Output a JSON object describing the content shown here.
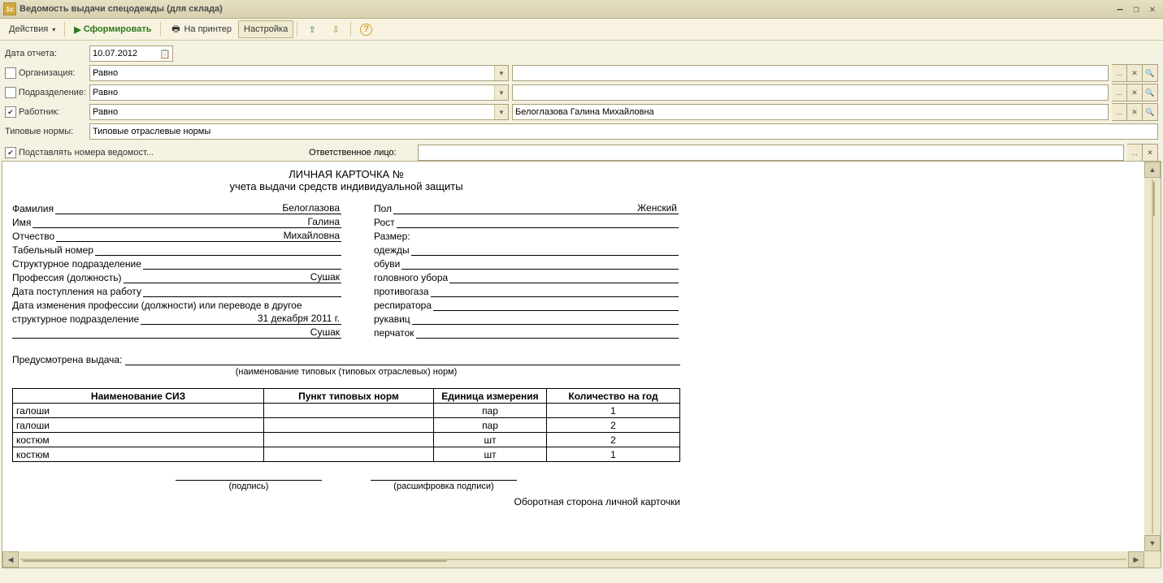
{
  "window": {
    "title": "Ведомость выдачи спецодежды (для склада)"
  },
  "toolbar": {
    "actions": "Действия",
    "form": "Сформировать",
    "print": "На принтер",
    "setup": "Настройка"
  },
  "filters": {
    "date_label": "Дата отчета:",
    "date": "10.07.2012",
    "org_label": "Организация:",
    "org_op": "Равно",
    "dep_label": "Подразделение:",
    "dep_op": "Равно",
    "worker_label": "Работник:",
    "worker_op": "Равно",
    "worker_val": "Белоглазова Галина Михайловна",
    "norms_label": "Типовые нормы:",
    "norms_val": "Типовые отраслевые нормы",
    "subst_label": "Подставлять номера ведомост...",
    "resp_label": "Ответственное лицо:"
  },
  "doc": {
    "title1": "ЛИЧНАЯ КАРТОЧКА №",
    "title2": "учета выдачи средств индивидуальной защиты",
    "surname_l": "Фамилия",
    "surname_v": "Белоглазова",
    "name_l": "Имя",
    "name_v": "Галина",
    "patr_l": "Отчество",
    "patr_v": "Михайловна",
    "tab_l": "Табельный номер",
    "struct_l": "Структурное подразделение",
    "prof_l": "Профессия (должность)",
    "prof_v": "Сушак",
    "hire_l": "Дата поступления на работу",
    "change_l": "Дата изменения профессии (должности) или переводе в другое",
    "change_l2": "структурное подразделение",
    "change_v": "31 декабря 2011 г.",
    "change_v2": "Сушак",
    "sex_l": "Пол",
    "sex_v": "Женский",
    "height_l": "Рост",
    "size_l": "Размер:",
    "clothes_l": "одежды",
    "shoes_l": "обуви",
    "head_l": "головного убора",
    "gas_l": "противогаза",
    "resp_l": "респиратора",
    "mitt_l": "рукавиц",
    "glove_l": "перчаток",
    "pre_l": "Предусмотрена выдача:",
    "pre_note": "(наименование типовых (типовых отраслевых) норм)",
    "th1": "Наименование СИЗ",
    "th2": "Пункт типовых норм",
    "th3": "Единица измерения",
    "th4": "Количество на год",
    "rows": [
      {
        "n": "галоши",
        "u": "пар",
        "q": "1"
      },
      {
        "n": "галоши",
        "u": "пар",
        "q": "2"
      },
      {
        "n": "костюм",
        "u": "шт",
        "q": "2"
      },
      {
        "n": "костюм",
        "u": "шт",
        "q": "1"
      }
    ],
    "sig1": "(подпись)",
    "sig2": "(расшифровка подписи)",
    "back": "Оборотная сторона личной карточки"
  }
}
